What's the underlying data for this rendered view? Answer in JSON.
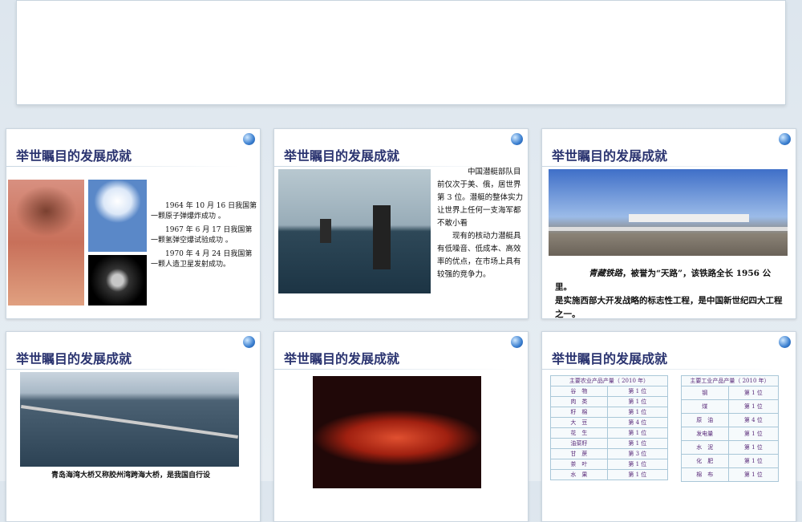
{
  "slides": [
    {
      "title": "举世瞩目的发展成就",
      "paras": [
        "1964 年 10 月 16 日我国第一颗原子弹爆炸成功 。",
        "1967 年 6 月 17 日我国第一颗氢弹空爆试验成功 。",
        "1970 年 4 月 24 日我国第一颗人造卫星发射成功。"
      ]
    },
    {
      "title": "举世瞩目的发展成就",
      "paras": [
        "中国潜艇部队目前仅次于美、俄，居世界第 3 位。潜艇的整体实力让世界上任何一支海军都不敢小看",
        "现有的核动力潜艇具有低噪音、低成本、高效率的优点，在市场上具有较强的竞争力。"
      ]
    },
    {
      "title": "举世瞩目的发展成就",
      "italic": "青藏铁路",
      "line1": "，被誉为“天路”，该铁路全长 1956 公里。",
      "line2": "是实施西部大开发战略的标志性工程，是中国新世纪四大工程之一。"
    },
    {
      "title": "举世瞩目的发展成就",
      "caption": "青岛海湾大桥又称胶州湾跨海大桥，是我国自行设"
    },
    {
      "title": "举世瞩目的发展成就"
    },
    {
      "title": "举世瞩目的发展成就",
      "agri": {
        "header": "主要农业产品产量（ 2010 年）",
        "rows": [
          [
            "谷　物",
            "第 1 位"
          ],
          [
            "肉　类",
            "第 1 位"
          ],
          [
            "籽　棉",
            "第 1 位"
          ],
          [
            "大　豆",
            "第 4 位"
          ],
          [
            "花　生",
            "第 1 位"
          ],
          [
            "油菜籽",
            "第 1 位"
          ],
          [
            "甘　蔗",
            "第 3 位"
          ],
          [
            "茶　叶",
            "第 1 位"
          ],
          [
            "水　果",
            "第 1 位"
          ]
        ]
      },
      "ind": {
        "header": "主要工业产品产量（ 2010 年）",
        "rows": [
          [
            "钢",
            "第 1 位"
          ],
          [
            "煤",
            "第 1 位"
          ],
          [
            "原　油",
            "第 4 位"
          ],
          [
            "发电量",
            "第 1 位"
          ],
          [
            "水　泥",
            "第 1 位"
          ],
          [
            "化　肥",
            "第 1 位"
          ],
          [
            "棉　布",
            "第 1 位"
          ]
        ]
      }
    }
  ]
}
